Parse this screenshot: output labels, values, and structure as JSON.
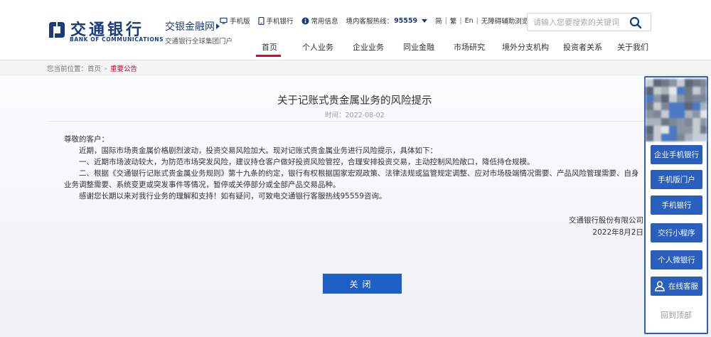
{
  "brand": {
    "logo_cn": "交通银行",
    "logo_en": "BANK OF COMMUNICATIONS",
    "site_name": "交银金融网",
    "site_sub": "交通银行全球集团门户",
    "color": "#1a3a7a"
  },
  "toplinks": {
    "mobile_site": "手机版",
    "mobile_bank": "手机银行",
    "faq": "常用信息",
    "hotline_label": "境内客服热线：",
    "hotline_number": "95559",
    "lang_simplified": "简",
    "lang_traditional": "繁",
    "lang_en": "En",
    "accessibility": "无障碍辅助浏览"
  },
  "search": {
    "placeholder": "请输入您要搜索的关键词"
  },
  "nav": [
    {
      "label": "首页",
      "active": true
    },
    {
      "label": "个人业务"
    },
    {
      "label": "企业业务"
    },
    {
      "label": "同业金融"
    },
    {
      "label": "市场研究"
    },
    {
      "label": "境外分支机构"
    },
    {
      "label": "投资者关系"
    },
    {
      "label": "关于我们"
    }
  ],
  "breadcrumb": {
    "prefix": "您当前位置：",
    "home": "首页",
    "current": "重要公告"
  },
  "article": {
    "title": "关于记账式贵金属业务的风险提示",
    "time": "时间：2022-08-02",
    "greeting": "尊敬的客户：",
    "p1": "近期，国际市场贵金属价格剧烈波动，投资交易风险加大。现对记账式贵金属业务进行风险提示，具体如下：",
    "p2": "一、近期市场波动较大，为防范市场突发风险，建议持仓客户做好投资风险管控，合理安排投资交易，主动控制风险敞口，降低持仓规模。",
    "p3": "二、根据《交通银行记账式贵金属业务规则》第十九条的约定，银行有权根据国家宏观政策、法律法规或监管规定调整、应对市场极端情况需要、产品风险管理需要、自身业务调整需要、系统变更或突发事件等情况，暂停或关停部分或全部产品交易品种。",
    "p4": "感谢您长期以来对我行业务的理解和支持！如有疑问，可致电交通银行客服热线95559咨询。",
    "signer": "交通银行股份有限公司",
    "date": "2022年8月2日",
    "close_label": "关闭"
  },
  "side_panel": {
    "items": [
      "企业手机银行",
      "手机版门户",
      "手机银行",
      "交行小程序",
      "个人微银行",
      "在线客服"
    ],
    "back_top": "回到顶部",
    "accent": "#2a5fbf"
  }
}
